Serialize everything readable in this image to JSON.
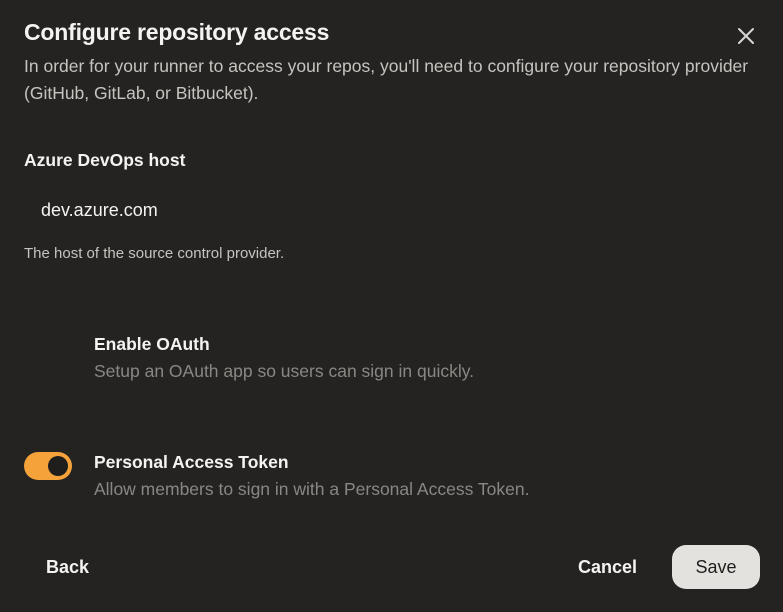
{
  "dialog": {
    "title": "Configure repository access",
    "subtitle": "In order for your runner to access your repos, you'll need to configure your repository provider (GitHub, GitLab, or Bitbucket).",
    "close_icon": "close-icon"
  },
  "host": {
    "label": "Azure DevOps host",
    "value": "dev.azure.com",
    "help": "The host of the source control provider."
  },
  "options": [
    {
      "title": "Enable OAuth",
      "description": "Setup an OAuth app so users can sign in quickly.",
      "enabled": false
    },
    {
      "title": "Personal Access Token",
      "description": "Allow members to sign in with a Personal Access Token.",
      "enabled": true
    }
  ],
  "colors": {
    "background": "#242322",
    "accent": "#f5a23a",
    "primary_button": "#e4e2df"
  },
  "footer": {
    "back_label": "Back",
    "cancel_label": "Cancel",
    "save_label": "Save"
  }
}
